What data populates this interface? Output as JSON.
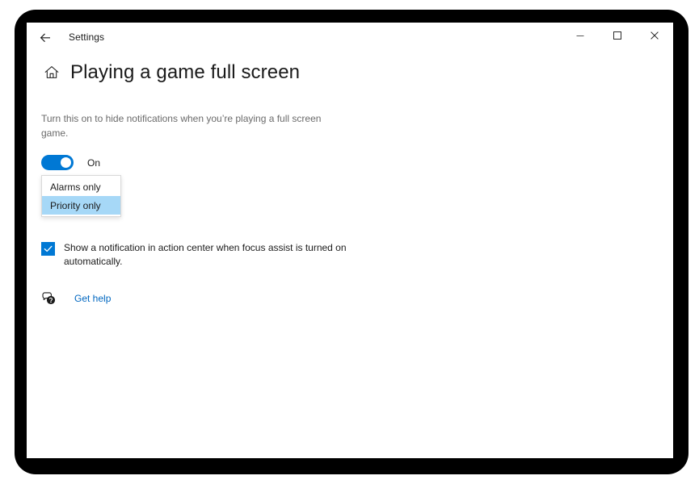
{
  "window": {
    "app_title": "Settings",
    "back_icon": "back-arrow-icon",
    "caption": {
      "minimize_icon": "minimize-icon",
      "maximize_icon": "maximize-icon",
      "close_icon": "close-icon"
    }
  },
  "page": {
    "home_icon": "home-icon",
    "title": "Playing a game full screen",
    "description": "Turn this on to hide notifications when you’re playing a full screen game."
  },
  "toggle": {
    "label": "On",
    "state": "on",
    "accent_color": "#0078d4"
  },
  "dropdown": {
    "options": [
      {
        "label": "Alarms only",
        "selected": false
      },
      {
        "label": "Priority only",
        "selected": true
      }
    ],
    "highlight_color": "#a6d8f7",
    "border_color": "#d9d9d9"
  },
  "checkbox": {
    "label": "Show a notification in action center when focus assist is turned on automatically.",
    "checked": true,
    "color": "#0078d4"
  },
  "help": {
    "icon": "help-bubble-icon",
    "link_text": "Get help",
    "link_color": "#0067c0"
  }
}
